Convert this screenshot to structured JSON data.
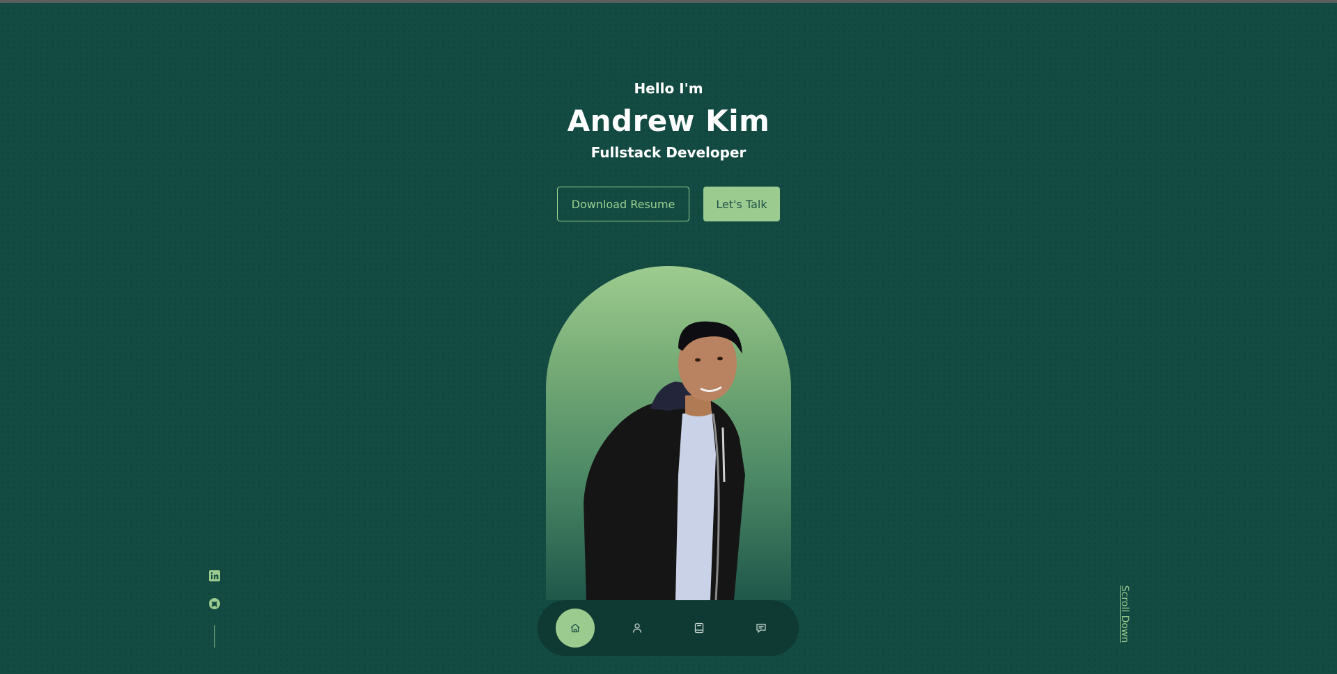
{
  "hero": {
    "greeting": "Hello I'm",
    "name": "Andrew Kim",
    "role": "Fullstack Developer"
  },
  "actions": {
    "download_resume": "Download Resume",
    "lets_talk": "Let's Talk"
  },
  "socials": [
    {
      "icon": "linkedin-icon"
    },
    {
      "icon": "github-icon"
    }
  ],
  "scroll_down": "Scroll Down",
  "nav": {
    "active": "home",
    "items": [
      {
        "id": "home",
        "icon": "home-icon"
      },
      {
        "id": "about",
        "icon": "user-icon"
      },
      {
        "id": "experience",
        "icon": "book-icon"
      },
      {
        "id": "contact",
        "icon": "message-icon"
      }
    ]
  },
  "colors": {
    "background": "#134b43",
    "accent": "#9bcb8e",
    "nav_background": "#0f3a34",
    "text": "#ffffff"
  }
}
